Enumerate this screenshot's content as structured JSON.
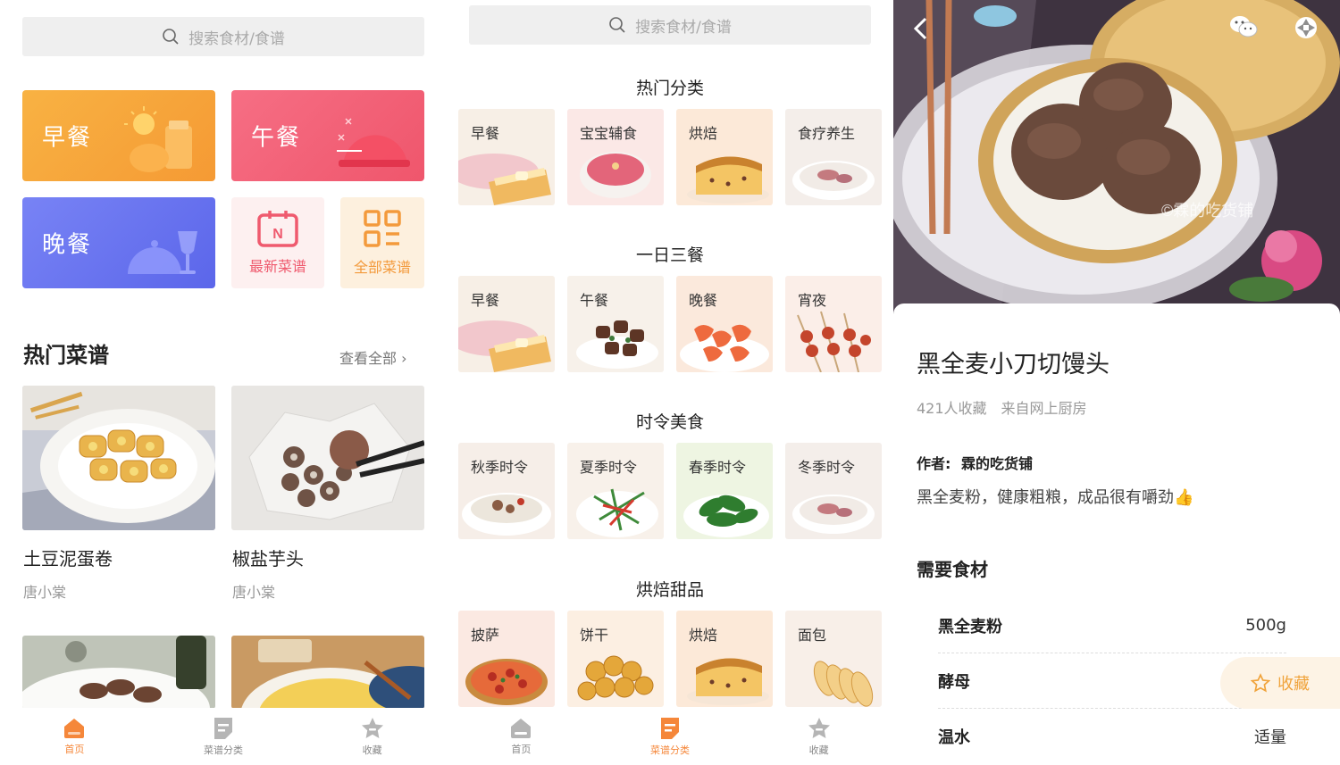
{
  "search": {
    "placeholder": "搜索食材/食谱"
  },
  "home": {
    "meals": [
      "早餐",
      "午餐",
      "晚餐"
    ],
    "shortcuts": [
      "最新菜谱",
      "全部菜谱"
    ],
    "hot_title": "热门菜谱",
    "see_all": "查看全部 ›",
    "recipes": [
      {
        "name": "土豆泥蛋卷",
        "author": "唐小棠"
      },
      {
        "name": "椒盐芋头",
        "author": "唐小棠"
      }
    ]
  },
  "tabs": [
    "首页",
    "菜谱分类",
    "收藏"
  ],
  "categories": {
    "sections": [
      {
        "title": "热门分类",
        "items": [
          "早餐",
          "宝宝辅食",
          "烘焙",
          "食疗养生"
        ]
      },
      {
        "title": "一日三餐",
        "items": [
          "早餐",
          "午餐",
          "晚餐",
          "宵夜"
        ]
      },
      {
        "title": "时令美食",
        "items": [
          "秋季时令",
          "夏季时令",
          "春季时令",
          "冬季时令"
        ]
      },
      {
        "title": "烘焙甜品",
        "items": [
          "披萨",
          "饼干",
          "烘焙",
          "面包"
        ]
      }
    ]
  },
  "detail": {
    "title": "黑全麦小刀切馒头",
    "meta": "421人收藏　来自网上厨房",
    "author_label": "作者:",
    "author": "霖的吃货铺",
    "description": "黑全麦粉，健康粗粮，成品很有嚼劲👍",
    "ingredients_title": "需要食材",
    "ingredients": [
      {
        "name": "黑全麦粉",
        "amount": "500g"
      },
      {
        "name": "酵母",
        "amount": ""
      },
      {
        "name": "温水",
        "amount": "适量"
      }
    ],
    "fav_label": "收藏",
    "watermark": "©霖的吃货铺"
  },
  "colors": {
    "accent": "#f5873a",
    "breakfast": "#f6a53b",
    "lunch": "#f15f76",
    "dinner": "#6c74f0"
  }
}
